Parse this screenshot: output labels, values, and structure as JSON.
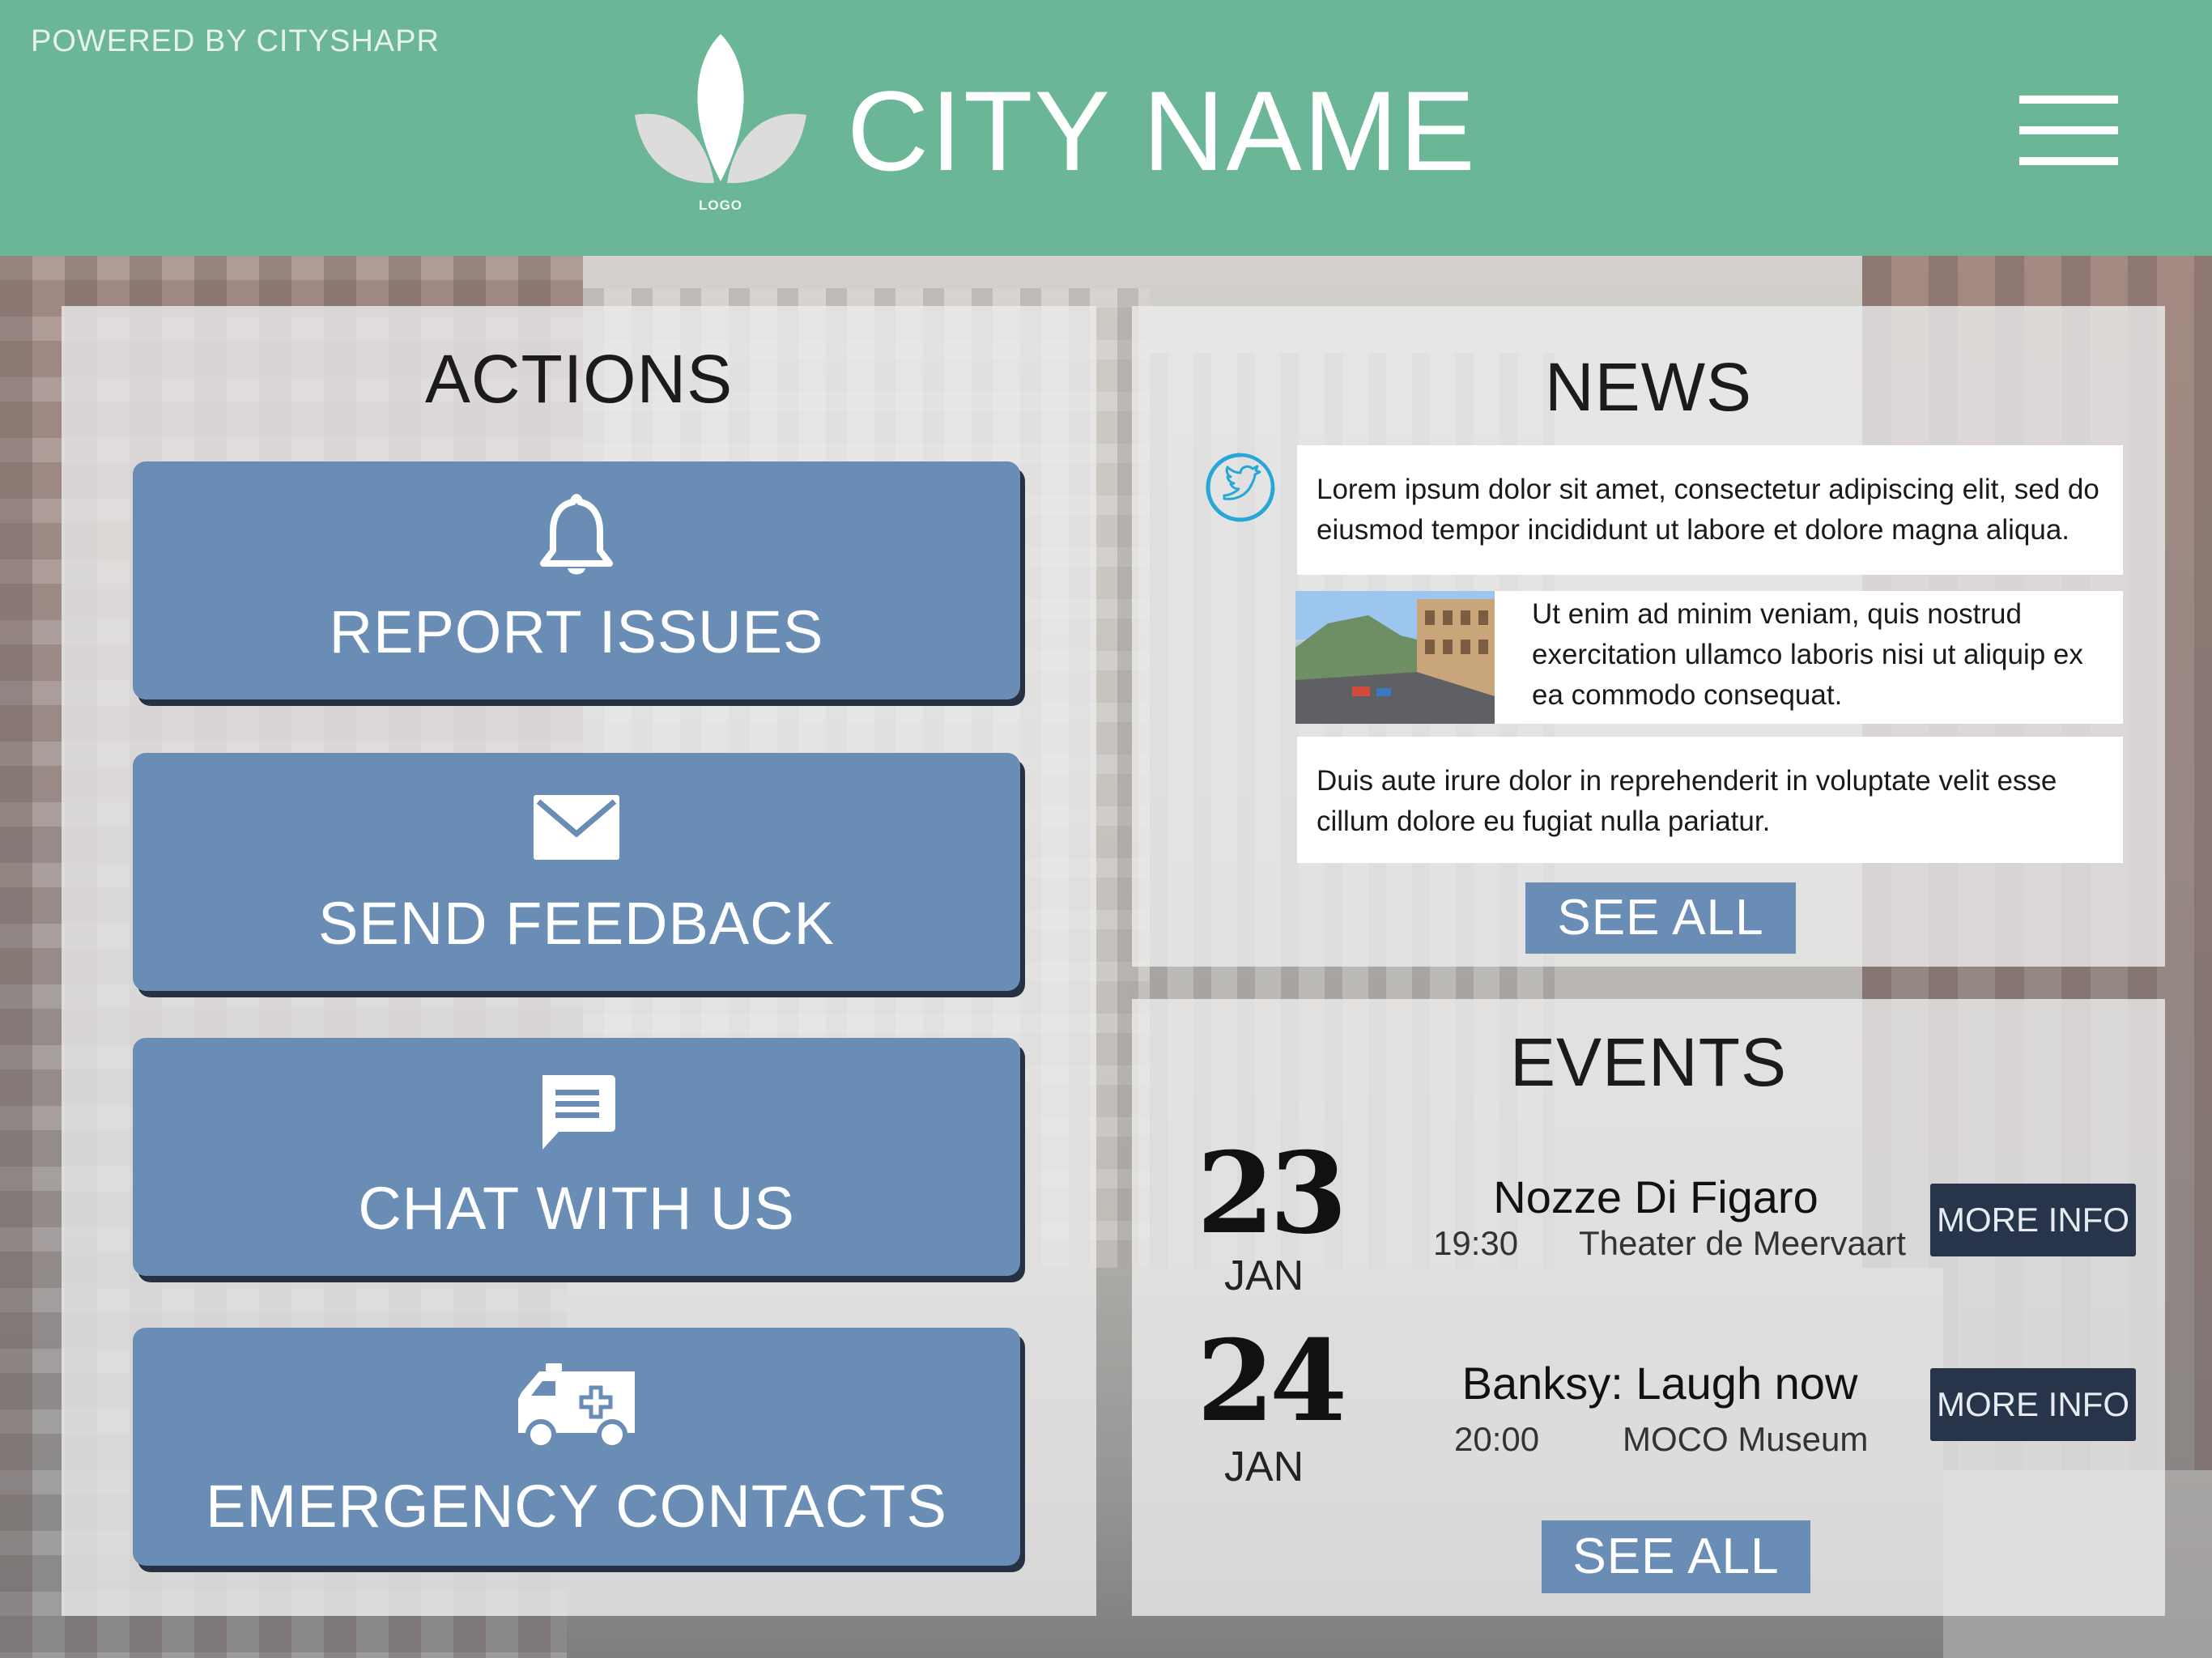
{
  "header": {
    "powered_by": "POWERED BY CITYSHAPR",
    "logo_text": "LOGO",
    "city_name": "CITY NAME",
    "menu_icon": "hamburger-menu-icon"
  },
  "actions": {
    "title": "ACTIONS",
    "buttons": [
      {
        "label": "REPORT ISSUES",
        "icon": "bell-icon"
      },
      {
        "label": "SEND FEEDBACK",
        "icon": "envelope-icon"
      },
      {
        "label": "CHAT WITH US",
        "icon": "chat-bubble-icon"
      },
      {
        "label": "EMERGENCY CONTACTS",
        "icon": "ambulance-icon"
      }
    ]
  },
  "news": {
    "title": "NEWS",
    "source_icon": "twitter-icon",
    "items": [
      {
        "text": "Lorem ipsum dolor sit amet, consectetur adipiscing elit, sed do eiusmod tempor incididunt ut labore et dolore magna aliqua."
      },
      {
        "text": "Ut enim ad minim veniam, quis nostrud exercitation ullamco laboris nisi ut aliquip ex ea commodo consequat.",
        "image": "city-street-photo"
      },
      {
        "text": "Duis aute irure dolor in reprehenderit in voluptate velit esse cillum dolore eu fugiat nulla pariatur."
      }
    ],
    "see_all": "SEE ALL"
  },
  "events": {
    "title": "EVENTS",
    "items": [
      {
        "day": "23",
        "month": "JAN",
        "title": "Nozze Di Figaro",
        "time": "19:30",
        "place": "Theater de Meervaart",
        "button": "MORE INFO"
      },
      {
        "day": "24",
        "month": "JAN",
        "title": "Banksy: Laugh now",
        "time": "20:00",
        "place": "MOCO Museum",
        "button": "MORE INFO"
      }
    ],
    "see_all": "SEE ALL"
  },
  "colors": {
    "header": "#6bb697",
    "action_button": "#6a8db5",
    "button_shadow": "#263242",
    "more_info": "#27344a"
  }
}
